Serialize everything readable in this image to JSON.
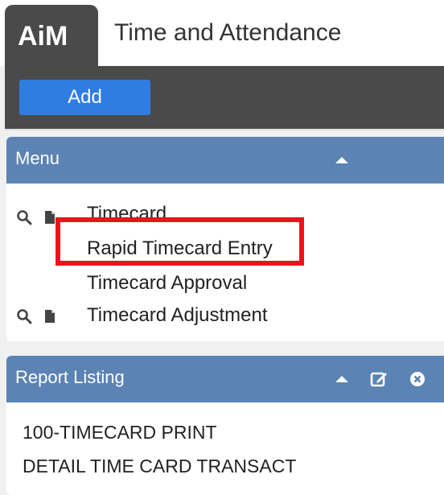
{
  "header": {
    "logo": "AiM",
    "app_title": "Time and Attendance"
  },
  "toolbar": {
    "add_label": "Add"
  },
  "menu_panel": {
    "title": "Menu",
    "collapse_icon": "caret-up-icon",
    "items": [
      {
        "label": "Timecard",
        "icons": [
          "search-icon",
          "document-icon"
        ]
      },
      {
        "label": "Rapid Timecard Entry",
        "highlighted": true
      },
      {
        "label": "Timecard Approval"
      },
      {
        "label": "Timecard Adjustment",
        "icons": [
          "search-icon",
          "document-icon"
        ]
      }
    ]
  },
  "report_panel": {
    "title": "Report Listing",
    "icons": [
      "caret-up-icon",
      "edit-icon",
      "close-circle-icon"
    ],
    "items": [
      {
        "label": "100-TIMECARD PRINT"
      },
      {
        "label": "DETAIL TIME CARD TRANSACT"
      }
    ]
  },
  "colors": {
    "header_dark": "#4a4a4a",
    "button_blue": "#2f7de1",
    "panel_header": "#5b83b4",
    "highlight_red": "#e8141c",
    "background": "#f0f0f0"
  }
}
